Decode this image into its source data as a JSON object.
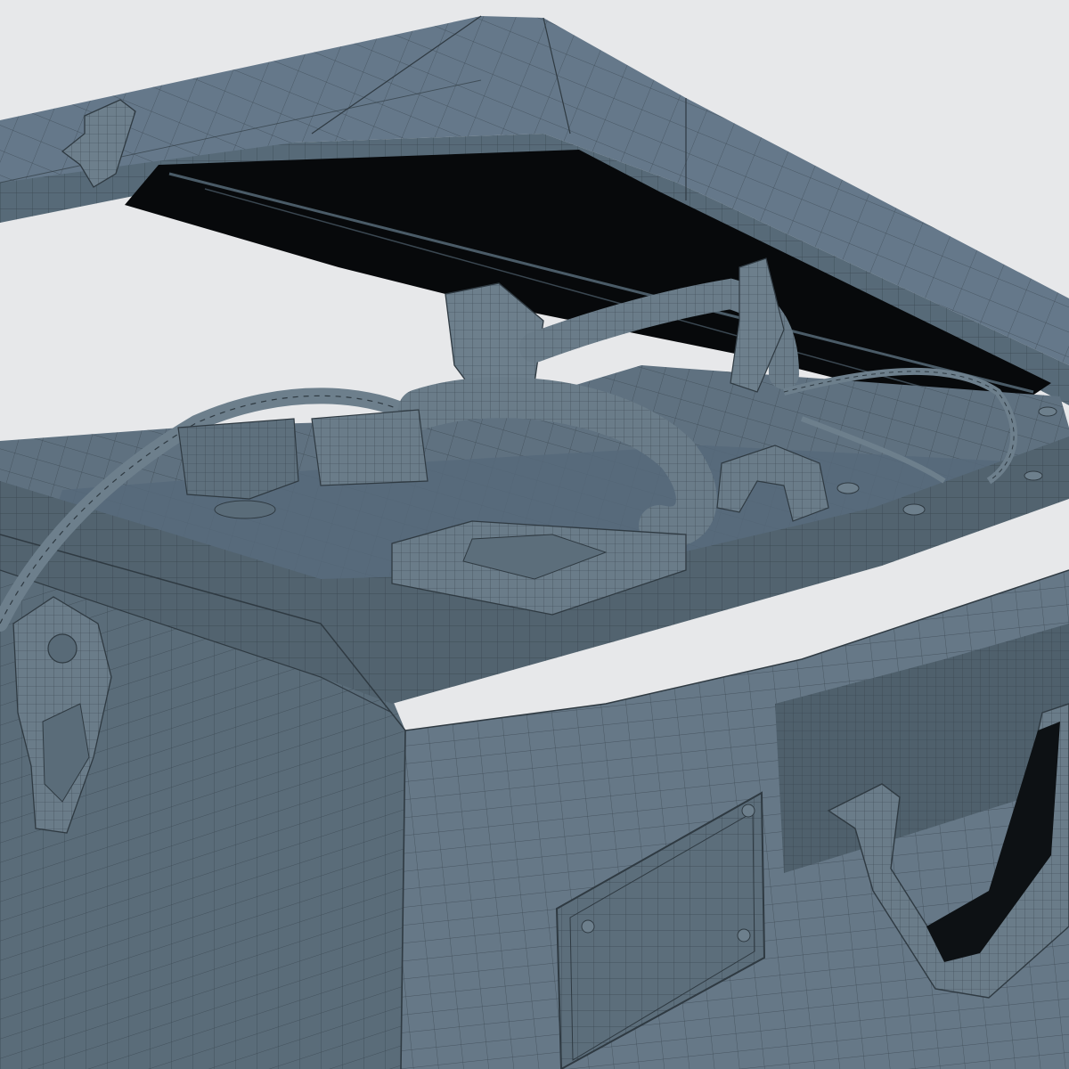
{
  "scene": {
    "subject": "wireframe-render-of-an-open-cased-metal-box",
    "render_style": "clay-shaded-mesh-with-visible-edges",
    "colors": {
      "background": "#e7e8ea",
      "surface_light": "#6d7f8c",
      "surface_mid": "#5d6f7c",
      "surface_dark": "#4a5b67",
      "surface_shadow": "#3a4751",
      "interior": "#07090b",
      "wire": "#2f3a42"
    },
    "parts": [
      "lid",
      "lid-interior",
      "case-top-deck",
      "case-front-wall",
      "case-side-wall",
      "front-rim",
      "label-plate",
      "carry-handle",
      "side-latch",
      "lid-latch",
      "coiled-strap",
      "rectangular-pad",
      "hinge-bracket",
      "rivets"
    ]
  }
}
